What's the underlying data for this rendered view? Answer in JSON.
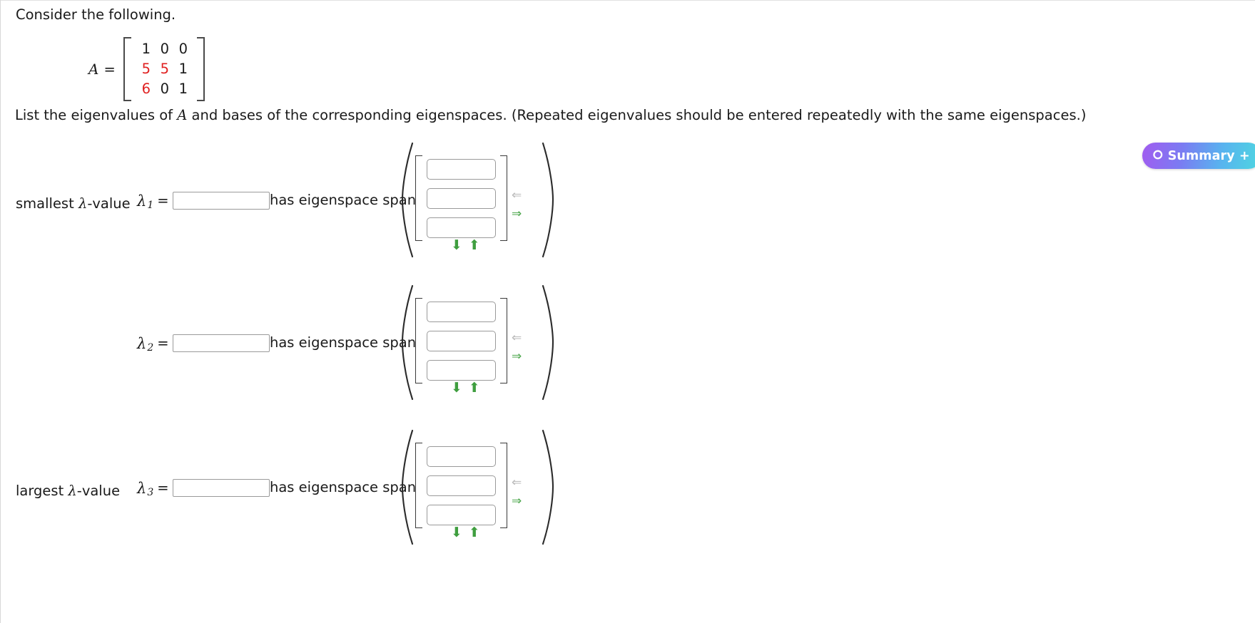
{
  "prompt": "Consider the following.",
  "matrix": {
    "label": "A",
    "equals": "=",
    "rows": [
      [
        {
          "v": "1",
          "c": "black"
        },
        {
          "v": "0",
          "c": "black"
        },
        {
          "v": "0",
          "c": "black"
        }
      ],
      [
        {
          "v": "5",
          "c": "red"
        },
        {
          "v": "5",
          "c": "red"
        },
        {
          "v": "1",
          "c": "black"
        }
      ],
      [
        {
          "v": "6",
          "c": "red"
        },
        {
          "v": "0",
          "c": "black"
        },
        {
          "v": "1",
          "c": "black"
        }
      ]
    ]
  },
  "instruction": {
    "part1": "List the eigenvalues of ",
    "var": "A",
    "part2": " and bases of the corresponding eigenspaces. (Repeated eigenvalues should be entered repeatedly with the same eigenspaces.)"
  },
  "summary_button": {
    "icon": "circle-plus-icon",
    "icon_glyph": "⭘",
    "label": "Summary +"
  },
  "eigen_rows": [
    {
      "rank_label_pre": "smallest ",
      "rank_label_var": "λ",
      "rank_label_post": "-value",
      "lambda_symbol": "λ",
      "lambda_subscript": "1",
      "equals": "=",
      "value": "",
      "placeholder": "",
      "span_text": "has eigenspace span",
      "vector": [
        "",
        "",
        ""
      ],
      "vector_placeholders": [
        "",
        "",
        ""
      ],
      "arrow_left": "⇐",
      "arrow_right": "⇒",
      "arrow_down": "⬇",
      "arrow_up": "⬆"
    },
    {
      "rank_label_pre": "",
      "rank_label_var": "",
      "rank_label_post": "",
      "lambda_symbol": "λ",
      "lambda_subscript": "2",
      "equals": "=",
      "value": "",
      "placeholder": "",
      "span_text": "has eigenspace span",
      "vector": [
        "",
        "",
        ""
      ],
      "vector_placeholders": [
        "",
        "",
        ""
      ],
      "arrow_left": "⇐",
      "arrow_right": "⇒",
      "arrow_down": "⬇",
      "arrow_up": "⬆"
    },
    {
      "rank_label_pre": "largest ",
      "rank_label_var": "λ",
      "rank_label_post": "-value",
      "lambda_symbol": "λ",
      "lambda_subscript": "3",
      "equals": "=",
      "value": "",
      "placeholder": "",
      "span_text": "has eigenspace span",
      "vector": [
        "",
        "",
        ""
      ],
      "vector_placeholders": [
        "",
        "",
        ""
      ],
      "arrow_left": "⇐",
      "arrow_right": "⇒",
      "arrow_down": "⬇",
      "arrow_up": "⬆"
    }
  ],
  "colors": {
    "matrix_highlight": "#e02020",
    "matrix_normal": "#1a1a1a",
    "arrow_green": "#3f9e3f",
    "arrow_gray": "#b9b9b9",
    "summary_gradient_start": "#a15cf0",
    "summary_gradient_end": "#4ed7e0"
  }
}
